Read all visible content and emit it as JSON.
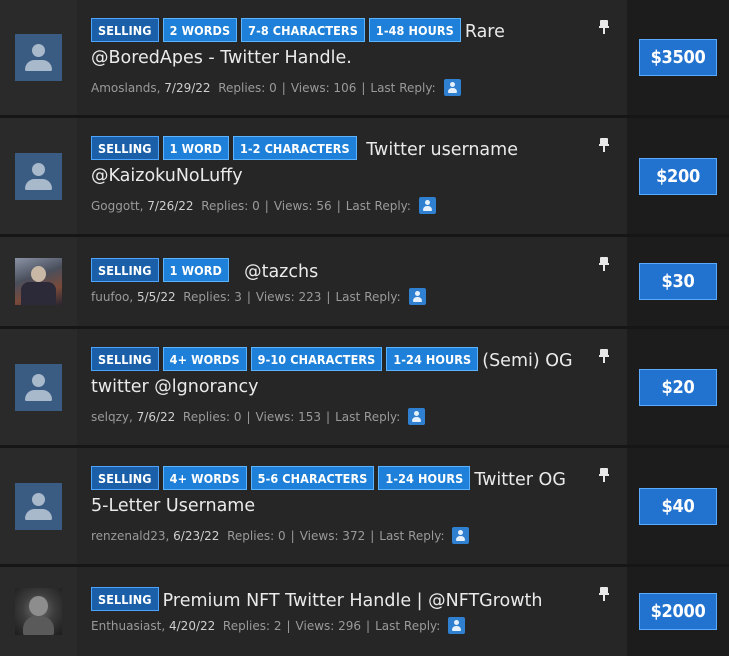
{
  "threads": [
    {
      "tags": [
        "SELLING",
        "2 WORDS",
        "7-8 CHARACTERS",
        "1-48 HOURS"
      ],
      "title": "Rare @BoredApes - Twitter Handle.",
      "author": "Amoslands",
      "date": "7/29/22",
      "replies_label": "Replies: 0",
      "views_label": "Views: 106",
      "last_reply_label": "Last Reply:",
      "price": "$3500",
      "avatar": "default-avatar-icon"
    },
    {
      "tags": [
        "SELLING",
        "1 WORD",
        "1-2 CHARACTERS"
      ],
      "title": "Twitter username @KaizokuNoLuffy",
      "author": "Goggott",
      "date": "7/26/22",
      "replies_label": "Replies: 0",
      "views_label": "Views: 56",
      "last_reply_label": "Last Reply:",
      "price": "$200",
      "avatar": "default-avatar-icon"
    },
    {
      "tags": [
        "SELLING",
        "1 WORD"
      ],
      "title": "@tazchs",
      "author": "fuufoo",
      "date": "5/5/22",
      "replies_label": "Replies: 3",
      "views_label": "Views: 223",
      "last_reply_label": "Last Reply:",
      "price": "$30",
      "avatar": "photo-avatar"
    },
    {
      "tags": [
        "SELLING",
        "4+ WORDS",
        "9-10 CHARACTERS",
        "1-24 HOURS"
      ],
      "title": "(Semi) OG twitter @lgnorancy",
      "author": "selqzy",
      "date": "7/6/22",
      "replies_label": "Replies: 0",
      "views_label": "Views: 153",
      "last_reply_label": "Last Reply:",
      "price": "$20",
      "avatar": "default-avatar-icon"
    },
    {
      "tags": [
        "SELLING",
        "4+ WORDS",
        "5-6 CHARACTERS",
        "1-24 HOURS"
      ],
      "title": "Twitter OG 5-Letter Username",
      "author": "renzenald23",
      "date": "6/23/22",
      "replies_label": "Replies: 0",
      "views_label": "Views: 372",
      "last_reply_label": "Last Reply:",
      "price": "$40",
      "avatar": "default-avatar-icon"
    },
    {
      "tags": [
        "SELLING"
      ],
      "title": "Premium NFT Twitter Handle | @NFTGrowth",
      "author": "Enthuasiast",
      "date": "4/20/22",
      "replies_label": "Replies: 2",
      "views_label": "Views: 296",
      "last_reply_label": "Last Reply:",
      "price": "$2000",
      "avatar": "photo-avatar"
    }
  ],
  "colors": {
    "tag_blue": "#1e80d8",
    "price_blue": "#2272d0",
    "row_bg": "#262626"
  }
}
